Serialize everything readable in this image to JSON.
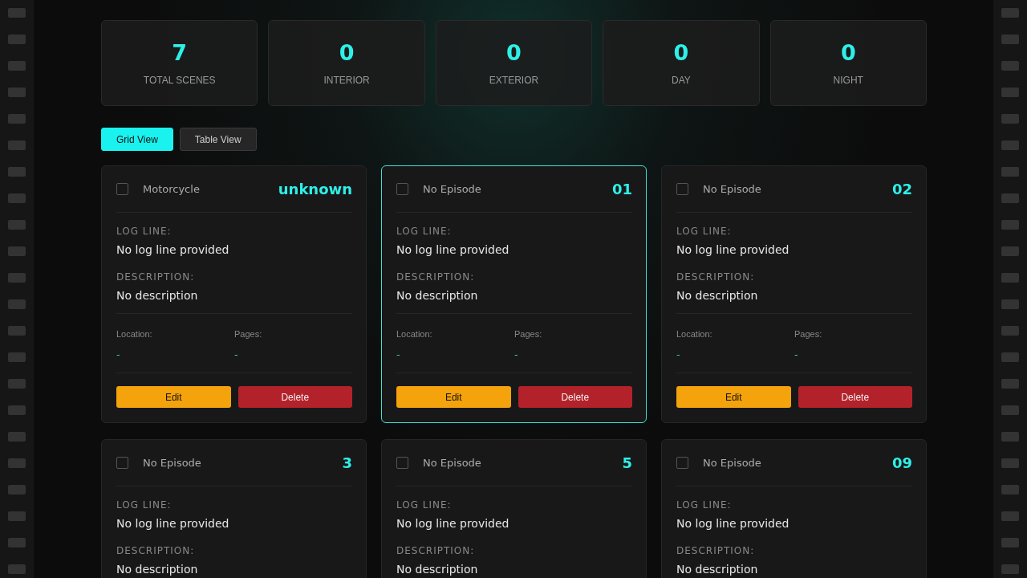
{
  "stats": [
    {
      "value": "7",
      "label": "TOTAL SCENES"
    },
    {
      "value": "0",
      "label": "INTERIOR"
    },
    {
      "value": "0",
      "label": "EXTERIOR"
    },
    {
      "value": "0",
      "label": "DAY"
    },
    {
      "value": "0",
      "label": "NIGHT"
    }
  ],
  "view_tabs": [
    {
      "label": "Grid View",
      "selected": true
    },
    {
      "label": "Table View",
      "selected": false
    }
  ],
  "scenes": [
    {
      "episode": "Motorcycle",
      "number": "unknown",
      "checked": false,
      "highlighted": false,
      "log_line_label": "LOG LINE:",
      "log_line": "No log line provided",
      "description_label": "DESCRIPTION:",
      "description": "No description",
      "location_label": "Location:",
      "location": "-",
      "pages_label": "Pages:",
      "pages": "-",
      "buttons": [
        "Edit",
        "Delete"
      ]
    },
    {
      "episode": "No Episode",
      "number": "01",
      "checked": false,
      "highlighted": true,
      "log_line_label": "LOG LINE:",
      "log_line": "No log line provided",
      "description_label": "DESCRIPTION:",
      "description": "No description",
      "location_label": "Location:",
      "location": "-",
      "pages_label": "Pages:",
      "pages": "-",
      "buttons": [
        "Edit",
        "Delete"
      ]
    },
    {
      "episode": "No Episode",
      "number": "02",
      "checked": false,
      "highlighted": false,
      "log_line_label": "LOG LINE:",
      "log_line": "No log line provided",
      "description_label": "DESCRIPTION:",
      "description": "No description",
      "location_label": "Location:",
      "location": "-",
      "pages_label": "Pages:",
      "pages": "-",
      "buttons": [
        "Edit",
        "Delete"
      ]
    },
    {
      "episode": "No Episode",
      "number": "3",
      "checked": false,
      "highlighted": false,
      "log_line_label": "LOG LINE:",
      "log_line": "No log line provided",
      "description_label": "DESCRIPTION:",
      "description": "No description"
    },
    {
      "episode": "No Episode",
      "number": "5",
      "checked": false,
      "highlighted": false,
      "log_line_label": "LOG LINE:",
      "log_line": "No log line provided",
      "description_label": "DESCRIPTION:",
      "description": "No description"
    },
    {
      "episode": "No Episode",
      "number": "09",
      "checked": false,
      "highlighted": false,
      "log_line_label": "LOG LINE:",
      "log_line": "No log line provided",
      "description_label": "DESCRIPTION:",
      "description": "No description"
    }
  ]
}
